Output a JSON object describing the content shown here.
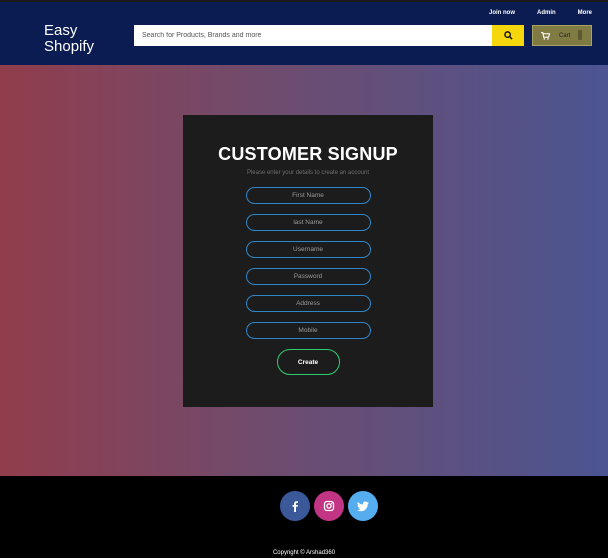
{
  "header": {
    "brand": "Easy Shopify",
    "nav": [
      "Join now",
      "Admin",
      "More"
    ],
    "search_placeholder": "Search for Products, Brands and more",
    "cart_label": "Cart"
  },
  "signup": {
    "title": "CUSTOMER SIGNUP",
    "subtitle": "Please enter your details to create an account",
    "fields": [
      "First Name",
      "last Name",
      "Username",
      "Password",
      "Address",
      "Mobile"
    ],
    "submit_label": "Create"
  },
  "footer": {
    "social": [
      "facebook-icon",
      "instagram-icon",
      "twitter-icon"
    ],
    "social_colors": [
      "#3b5998",
      "#c13584",
      "#55acee"
    ],
    "copyright": "Copyright © Arshad360"
  },
  "colors": {
    "header_bg": "#0b1c52",
    "search_button": "#f5d70b",
    "cart_button": "#7f7b42",
    "field_border": "#2e86c8",
    "create_border": "#2ecc71"
  }
}
